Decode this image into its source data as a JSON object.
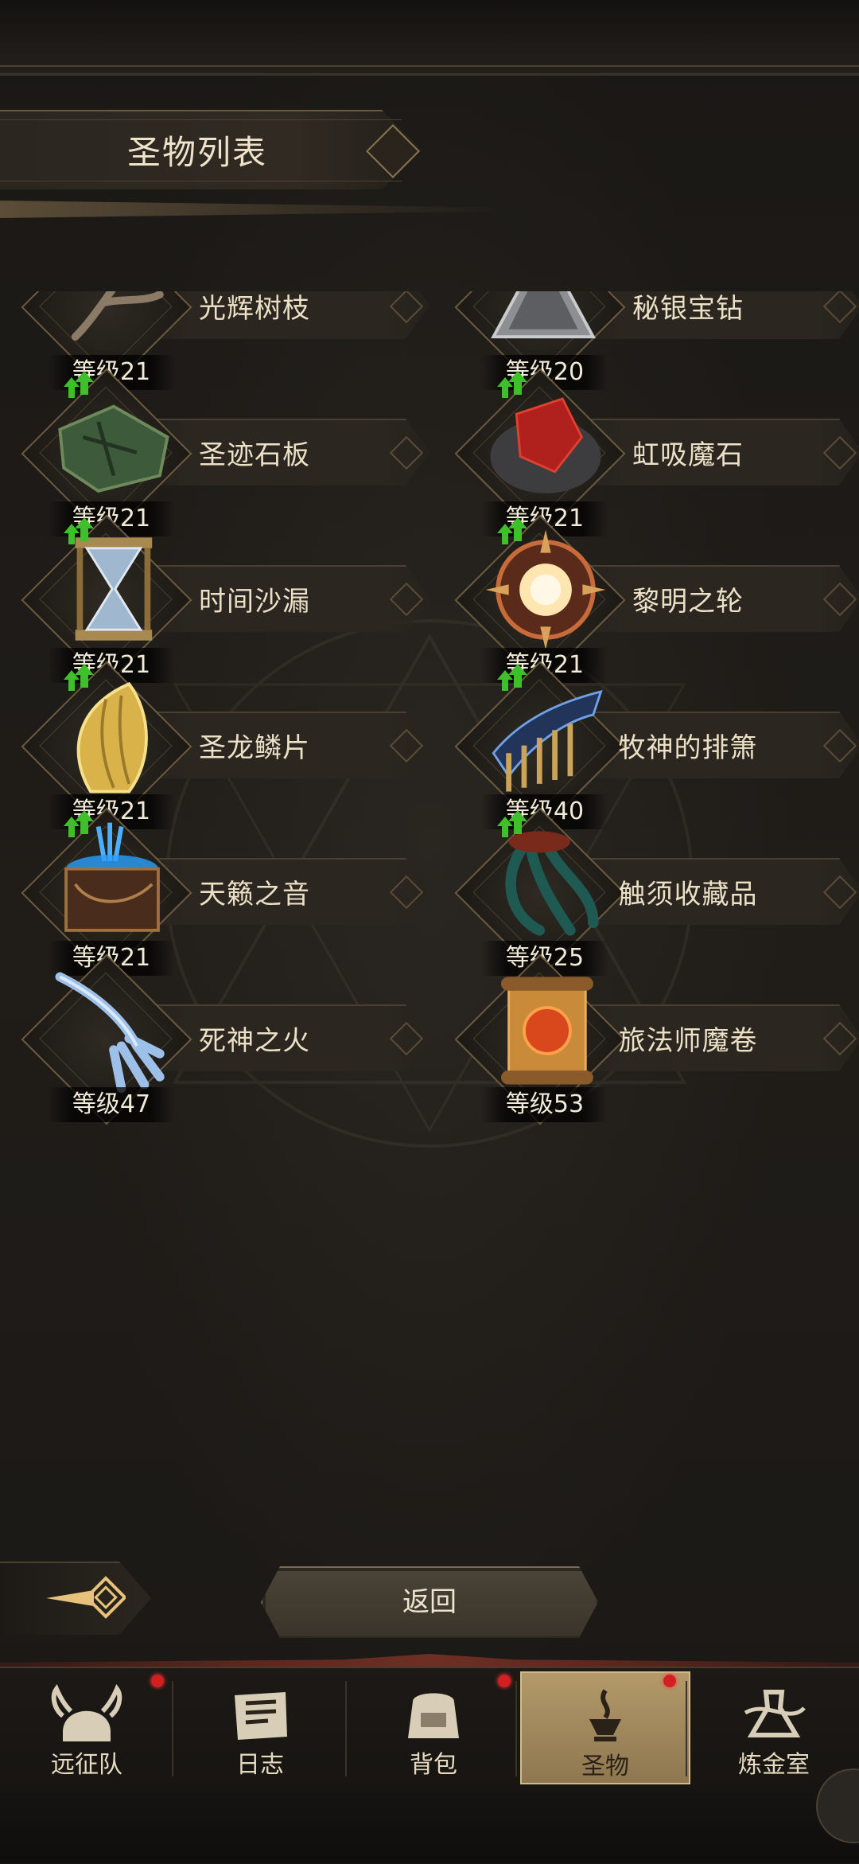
{
  "header": {
    "title": "圣物列表"
  },
  "relics": [
    {
      "name": "光辉树枝",
      "level": "等级21",
      "upgrade": false,
      "art": "branch"
    },
    {
      "name": "秘银宝钻",
      "level": "等级20",
      "upgrade": false,
      "art": "gem"
    },
    {
      "name": "圣迹石板",
      "level": "等级21",
      "upgrade": true,
      "art": "slab"
    },
    {
      "name": "虹吸魔石",
      "level": "等级21",
      "upgrade": true,
      "art": "ruby"
    },
    {
      "name": "时间沙漏",
      "level": "等级21",
      "upgrade": true,
      "art": "hourglass"
    },
    {
      "name": "黎明之轮",
      "level": "等级21",
      "upgrade": true,
      "art": "wheel"
    },
    {
      "name": "圣龙鳞片",
      "level": "等级21",
      "upgrade": true,
      "art": "scale"
    },
    {
      "name": "牧神的排箫",
      "level": "等级40",
      "upgrade": true,
      "art": "panpipe"
    },
    {
      "name": "天籁之音",
      "level": "等级21",
      "upgrade": true,
      "art": "box"
    },
    {
      "name": "触须收藏品",
      "level": "等级25",
      "upgrade": true,
      "art": "tentacle"
    },
    {
      "name": "死神之火",
      "level": "等级47",
      "upgrade": false,
      "art": "claw"
    },
    {
      "name": "旅法师魔卷",
      "level": "等级53",
      "upgrade": false,
      "art": "scroll"
    }
  ],
  "controls": {
    "return_label": "返回"
  },
  "nav": [
    {
      "label": "远征队",
      "icon": "helmet-icon",
      "badge": true,
      "active": false
    },
    {
      "label": "日志",
      "icon": "journal-icon",
      "badge": false,
      "active": false
    },
    {
      "label": "背包",
      "icon": "backpack-icon",
      "badge": true,
      "active": false
    },
    {
      "label": "圣物",
      "icon": "relic-icon",
      "badge": true,
      "active": true
    },
    {
      "label": "炼金室",
      "icon": "alchemy-icon",
      "badge": false,
      "active": false
    }
  ],
  "colors": {
    "accent": "#b39a6a",
    "badge": "#d21f1f",
    "upgrade_arrow": "#3fbf2a"
  }
}
